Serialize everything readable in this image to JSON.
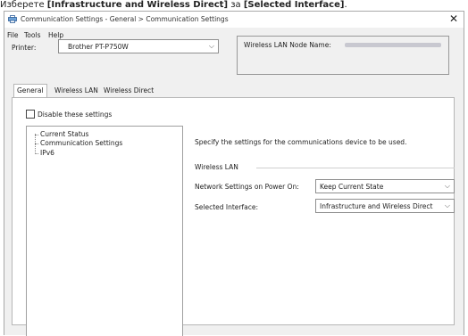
{
  "caption": {
    "prefix": "Изберете ",
    "bold1": "[Infrastructure and Wireless Direct]",
    "middle": " за ",
    "bold2": "[Selected Interface]",
    "suffix": "."
  },
  "window": {
    "title": "Communication Settings - General > Communication Settings",
    "close": "✕"
  },
  "menu": {
    "file": "File",
    "tools": "Tools",
    "help": "Help"
  },
  "printer": {
    "label": "Printer:",
    "value": "Brother PT-P750W"
  },
  "node": {
    "label": "Wireless LAN Node Name:"
  },
  "tabs": [
    "General",
    "Wireless LAN",
    "Wireless Direct"
  ],
  "disable": {
    "label": "Disable these settings",
    "checked": false
  },
  "tree": {
    "items": [
      "Current Status",
      "Communication Settings",
      "IPv6"
    ]
  },
  "main": {
    "description": "Specify the settings for the communications device to be used.",
    "group": "Wireless LAN",
    "network_label": "Network Settings on Power On:",
    "network_value": "Keep Current State",
    "interface_label": "Selected Interface:",
    "interface_value": "Infrastructure and Wireless Direct"
  },
  "icons": {
    "app": "printer-settings-icon",
    "chevron": "chevron-down-icon",
    "close": "close-icon"
  }
}
